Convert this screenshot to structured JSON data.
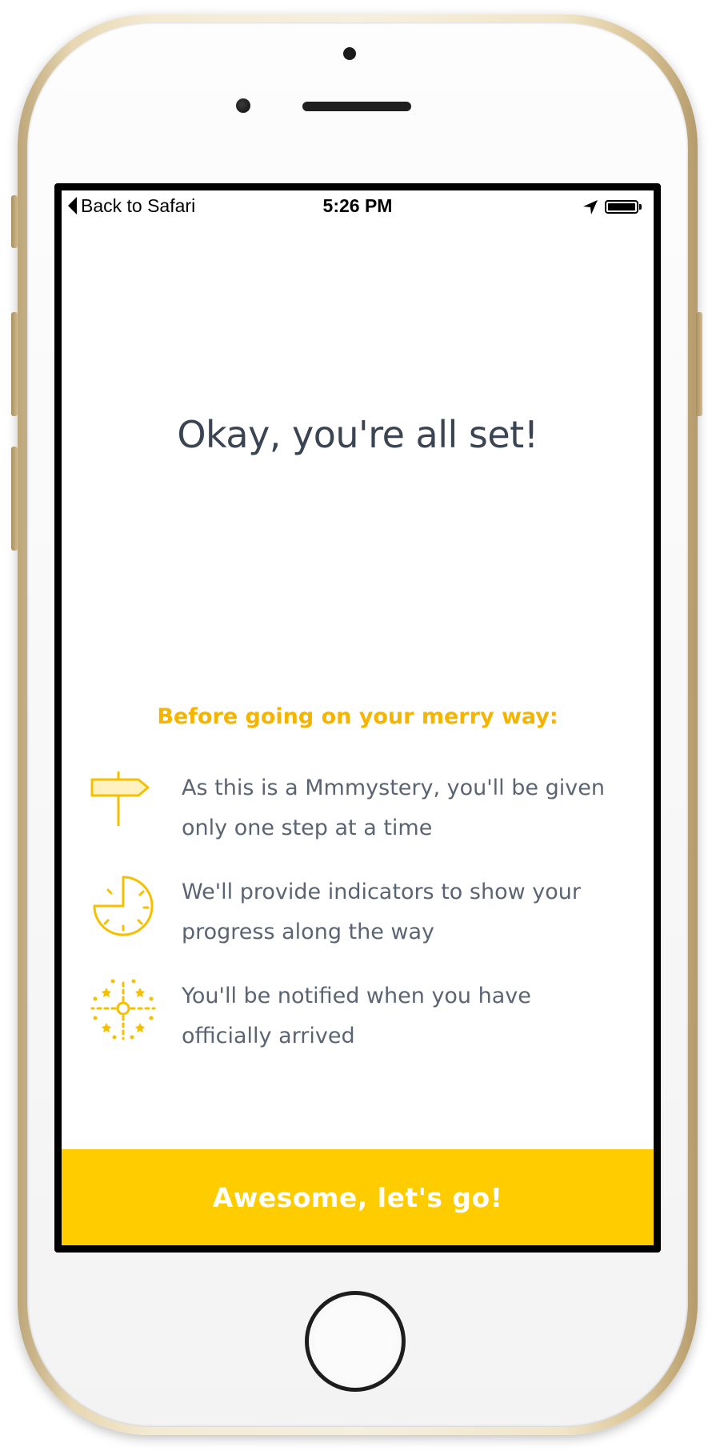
{
  "status_bar": {
    "back_label": "Back to Safari",
    "time": "5:26 PM",
    "battery_level": 1.0
  },
  "main": {
    "title": "Okay, you're all set!",
    "subtitle": "Before going on your merry way:",
    "tips": [
      {
        "icon": "signpost-icon",
        "text_line1": "As this is a Mmmystery, you'll be given",
        "text_line2": "only one step at a time"
      },
      {
        "icon": "timer-icon",
        "text_line1": "We'll provide indicators to show your",
        "text_line2": "progress along the way"
      },
      {
        "icon": "fireworks-icon",
        "text_line1": "You'll be notified when you have",
        "text_line2": "officially arrived"
      }
    ]
  },
  "cta": {
    "label": "Awesome, let's go!"
  },
  "colors": {
    "accent": "#ffcc00",
    "subtitle": "#f5b400",
    "icon": "#f5c000",
    "title_text": "#3a4452",
    "body_text": "#5b6472"
  }
}
